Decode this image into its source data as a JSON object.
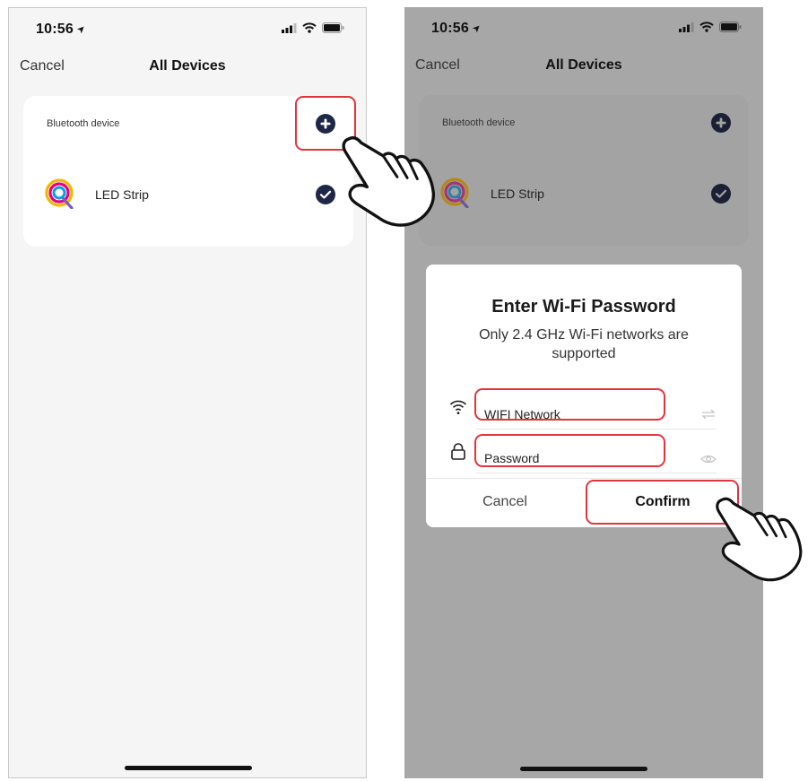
{
  "status_bar": {
    "time": "10:56"
  },
  "nav": {
    "cancel_label": "Cancel",
    "title": "All Devices"
  },
  "card": {
    "header": "Bluetooth device",
    "device_name": "LED Strip"
  },
  "dialog": {
    "title": "Enter Wi-Fi Password",
    "subtitle": "Only 2.4 GHz Wi-Fi networks are supported",
    "network_value": "WIFI Network",
    "password_placeholder": "Password",
    "cancel_label": "Cancel",
    "confirm_label": "Confirm"
  },
  "icons": {
    "location": "location-arrow-icon",
    "signal": "signal-icon",
    "wifi": "wifi-icon",
    "battery": "battery-icon",
    "add": "add-circle-icon",
    "check": "check-circle-icon",
    "lock": "lock-icon",
    "swap": "swap-icon",
    "eye": "eye-icon",
    "hand": "pointing-hand-icon"
  },
  "colors": {
    "accent_dark": "#1f2746",
    "highlight_red": "#e0353f",
    "dim_overlay": "#a7a7a7"
  }
}
